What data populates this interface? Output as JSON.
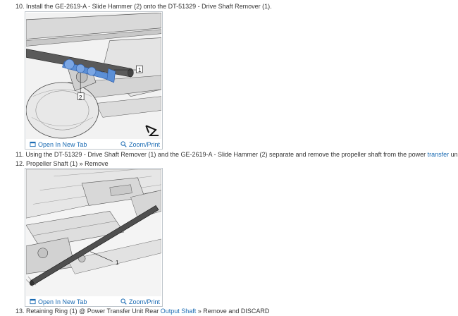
{
  "steps": [
    {
      "number": "10.",
      "text": "Install the GE-2619-A - Slide Hammer (2) onto the DT-51329 - Drive Shaft Remover (1)."
    },
    {
      "number": "11.",
      "text_before": "Using the DT-51329 - Drive Shaft Remover (1) and the GE-2619-A - Slide Hammer (2) separate and remove the propeller shaft from the power ",
      "link": "transfer",
      "text_after": " unit."
    },
    {
      "number": "12.",
      "text": "Propeller Shaft (1) » Remove"
    },
    {
      "number": "13.",
      "text_before": "Retaining Ring (1) @ Power Transfer Unit Rear ",
      "link": "Output Shaft",
      "text_after": " » Remove and DISCARD"
    }
  ],
  "figures": [
    {
      "callouts": [
        "1",
        "2"
      ],
      "open_label": "Open In New Tab",
      "zoom_label": "Zoom/Print"
    },
    {
      "callouts": [
        "1"
      ],
      "open_label": "Open In New Tab",
      "zoom_label": "Zoom/Print"
    }
  ],
  "colors": {
    "text": "#333333",
    "link": "#1a6bb3",
    "tool_highlight": "#5b8fd6",
    "figure_border": "#bfc6cc"
  },
  "icons": {
    "open": "open-in-new-tab-icon",
    "zoom": "zoom-magnifier-icon"
  }
}
